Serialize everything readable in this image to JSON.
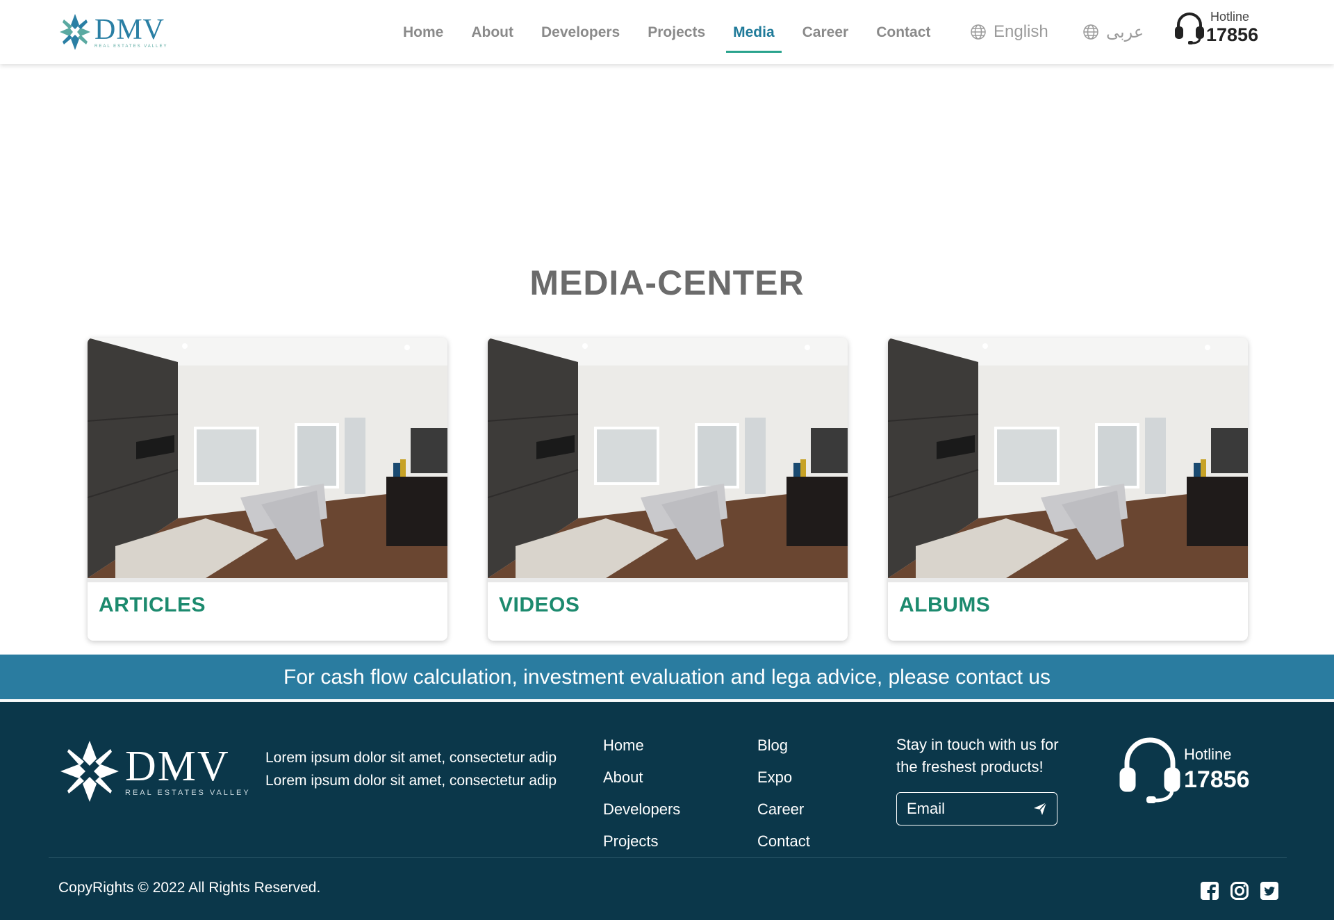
{
  "brand": {
    "name": "DMV",
    "tagline": "REAL ESTATES VALLEY"
  },
  "nav": {
    "items": [
      {
        "label": "Home"
      },
      {
        "label": "About"
      },
      {
        "label": "Developers"
      },
      {
        "label": "Projects"
      },
      {
        "label": "Media",
        "active": true
      },
      {
        "label": "Career"
      },
      {
        "label": "Contact"
      }
    ],
    "lang_en": "English",
    "lang_ar": "عربى",
    "hotline_label": "Hotline",
    "hotline_number": "17856"
  },
  "page": {
    "title": "MEDIA-CENTER"
  },
  "cards": [
    {
      "label": "ARTICLES"
    },
    {
      "label": "VIDEOS"
    },
    {
      "label": "ALBUMS"
    }
  ],
  "banner": {
    "text": "For cash flow calculation, investment evaluation and lega advice, please contact us"
  },
  "footer": {
    "description": "Lorem ipsum dolor sit amet, consectetur adip Lorem ipsum dolor sit amet, consectetur adip",
    "links_col1": [
      "Home",
      "About",
      "Developers",
      "Projects"
    ],
    "links_col2": [
      "Blog",
      "Expo",
      "Career",
      "Contact"
    ],
    "stay_text": "Stay in touch with us for the freshest products!",
    "email_placeholder": "Email",
    "hotline_label": "Hotline",
    "hotline_number": "17856",
    "copyright": "CopyRights © 2022 All Rights Reserved.",
    "social": [
      "facebook-icon",
      "instagram-icon",
      "twitter-icon"
    ]
  },
  "colors": {
    "primary": "#2a7ca0",
    "accent": "#1c8a6e",
    "footer_bg": "#0b374a",
    "nav_active": "#1f7a99"
  }
}
